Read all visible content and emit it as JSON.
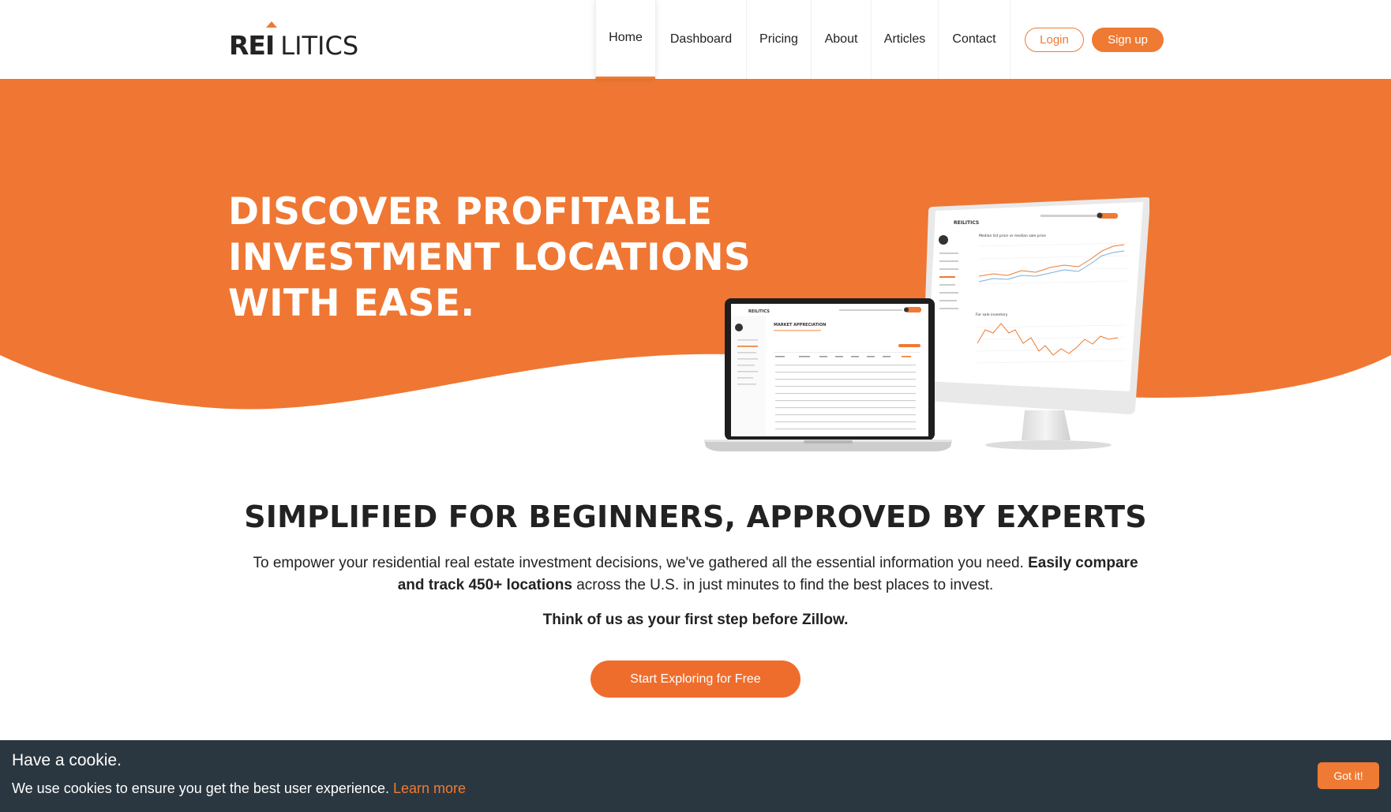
{
  "brand": {
    "logo_left": "REI",
    "logo_right": "LITICS",
    "accent": "#ef7a33"
  },
  "nav": {
    "items": [
      {
        "label": "Home",
        "active": true
      },
      {
        "label": "Dashboard"
      },
      {
        "label": "Pricing"
      },
      {
        "label": "About"
      },
      {
        "label": "Articles"
      },
      {
        "label": "Contact"
      }
    ],
    "login": "Login",
    "signup": "Sign up"
  },
  "hero": {
    "title_lines": [
      "DISCOVER PROFITABLE",
      "INVESTMENT LOCATIONS",
      "WITH EASE."
    ],
    "background": "#ef7733",
    "monitor": {
      "logo": "REILITICS",
      "chart1_title": "Median list price vs median sale price",
      "chart2_title": "For sale inventory"
    },
    "laptop": {
      "logo": "REILITICS",
      "heading": "MARKET APPRECIATION"
    }
  },
  "section": {
    "title": "SIMPLIFIED FOR BEGINNERS, APPROVED BY EXPERTS",
    "text_1": "To empower your residential real estate investment decisions, we've gathered all the essential information you need. ",
    "text_bold": "Easily compare and track 450+ locations",
    "text_2": " across the U.S. in just minutes to find the best places to invest.",
    "subtitle": "Think of us as your first step before Zillow.",
    "cta": "Start Exploring for Free"
  },
  "cookie": {
    "title": "Have a cookie.",
    "text": "We use cookies to ensure you get the best user experience. ",
    "link": "Learn more",
    "button": "Got it!"
  }
}
